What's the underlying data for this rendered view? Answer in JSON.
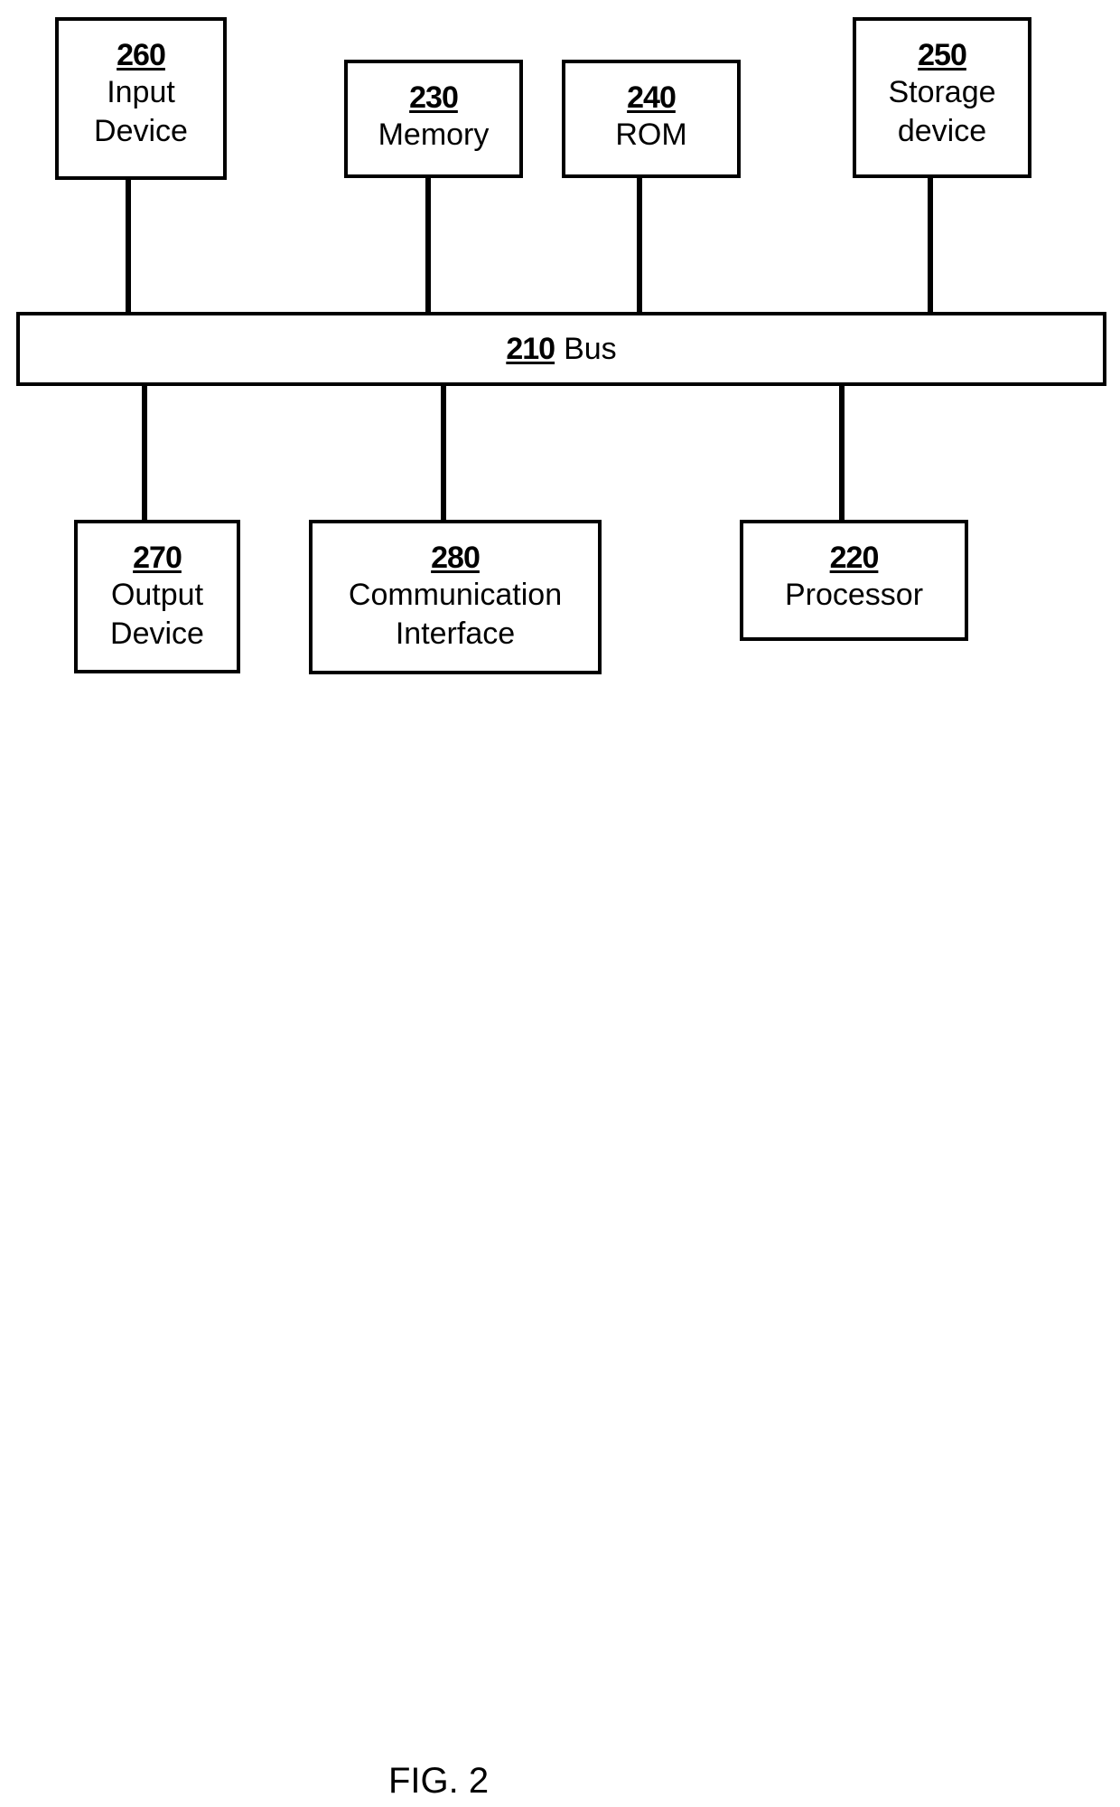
{
  "figure_label": "FIG. 2",
  "bus": {
    "ref": "210",
    "label": "Bus"
  },
  "top_components": [
    {
      "ref": "260",
      "lines": [
        "Input",
        "Device"
      ]
    },
    {
      "ref": "230",
      "lines": [
        "Memory"
      ]
    },
    {
      "ref": "240",
      "lines": [
        "ROM"
      ]
    },
    {
      "ref": "250",
      "lines": [
        "Storage",
        "device"
      ]
    }
  ],
  "bottom_components": [
    {
      "ref": "270",
      "lines": [
        "Output",
        "Device"
      ]
    },
    {
      "ref": "280",
      "lines": [
        "Communication",
        "Interface"
      ]
    },
    {
      "ref": "220",
      "lines": [
        "Processor"
      ]
    }
  ]
}
